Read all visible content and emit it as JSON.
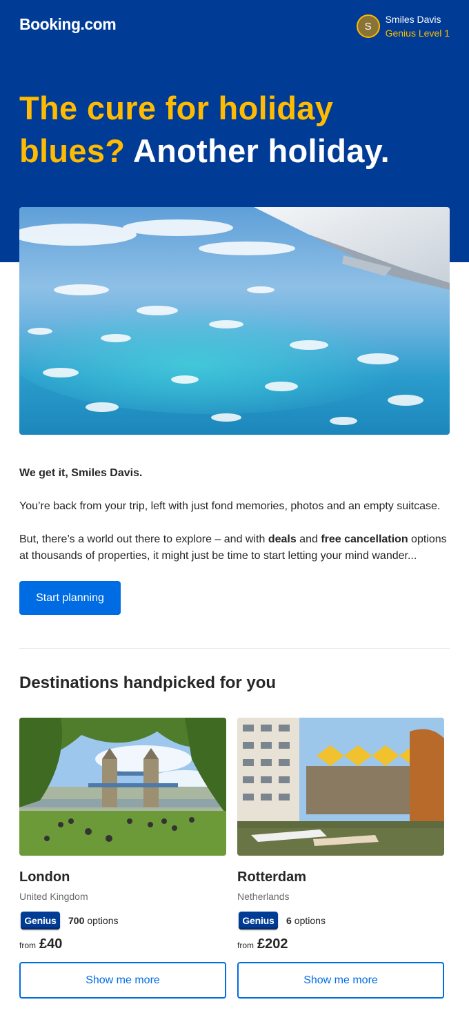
{
  "brand": {
    "logo": "Booking.com"
  },
  "user": {
    "initial": "S",
    "name": "Smiles Davis",
    "level": "Genius Level 1"
  },
  "hero": {
    "headline_yellow": "The cure for holiday blues?",
    "headline_white": "Another holiday."
  },
  "body": {
    "greeting": "We get it, Smiles Davis.",
    "para1": "You’re back from your trip, left with just fond memories, photos and an empty suitcase.",
    "para2_a": "But, there’s a world out there to explore – and with ",
    "para2_deals": "deals",
    "para2_b": " and ",
    "para2_free": "free cancellation",
    "para2_c": " options at thousands of properties, it might just be time to start letting your mind wander...",
    "cta": "Start planning"
  },
  "destinations": {
    "title": "Destinations handpicked for you",
    "items": [
      {
        "city": "London",
        "country": "United Kingdom",
        "genius": "Genius",
        "count": "700",
        "options_label": "options",
        "from": "from",
        "price": "£40",
        "button": "Show me more"
      },
      {
        "city": "Rotterdam",
        "country": "Netherlands",
        "genius": "Genius",
        "count": "6",
        "options_label": "options",
        "from": "from",
        "price": "£202",
        "button": "Show me more"
      }
    ]
  },
  "colors": {
    "brand_blue": "#003b95",
    "accent_yellow": "#febb02",
    "action_blue": "#006ce4"
  }
}
